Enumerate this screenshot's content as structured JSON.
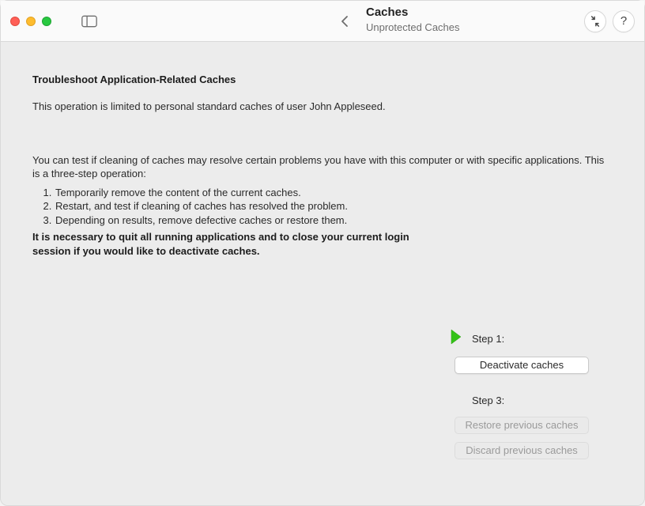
{
  "header": {
    "title": "Caches",
    "subtitle": "Unprotected Caches"
  },
  "page": {
    "heading": "Troubleshoot Application-Related Caches",
    "intro": "This operation is limited to personal standard caches of user John Appleseed.",
    "lead": "You can test if cleaning of caches may resolve certain problems you have with this computer or with specific applications. This is a three-step operation:",
    "steps": {
      "s1": "Temporarily remove the content of the current caches.",
      "s2": "Restart, and test if cleaning of caches has resolved the problem.",
      "s3": "Depending on results, remove defective caches or restore them."
    },
    "bold_note": "It is necessary to quit all running applications and to close your current login session if you would like to deactivate caches."
  },
  "actions": {
    "step1_label": "Step 1:",
    "deactivate": "Deactivate caches",
    "step3_label": "Step 3:",
    "restore": "Restore previous caches",
    "discard": "Discard previous caches"
  }
}
